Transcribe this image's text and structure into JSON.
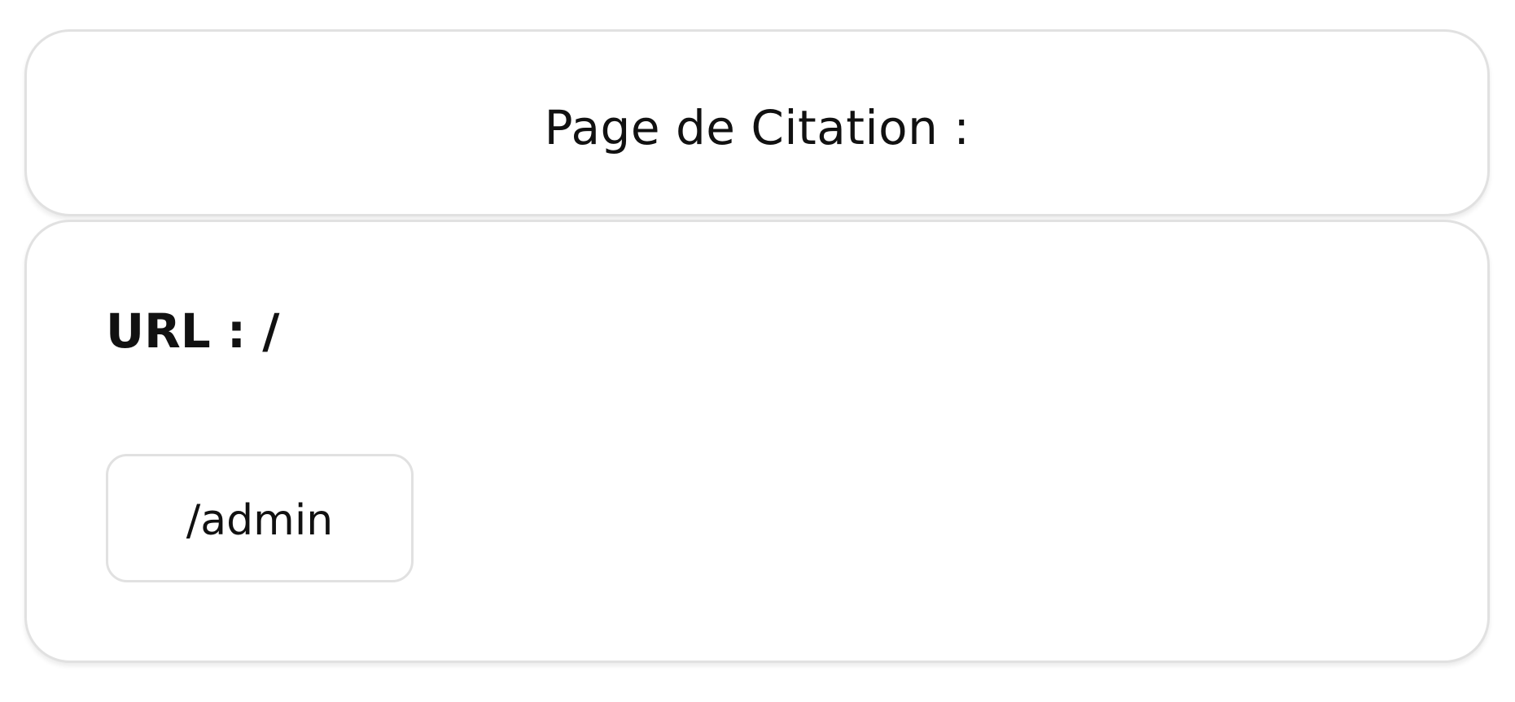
{
  "header": {
    "title": "Page de Citation :"
  },
  "main": {
    "url_label": "URL : /",
    "links": [
      {
        "label": "/admin"
      }
    ]
  },
  "colors": {
    "background": "#ffffff",
    "border": "#e1e1e1",
    "text": "#111111"
  }
}
